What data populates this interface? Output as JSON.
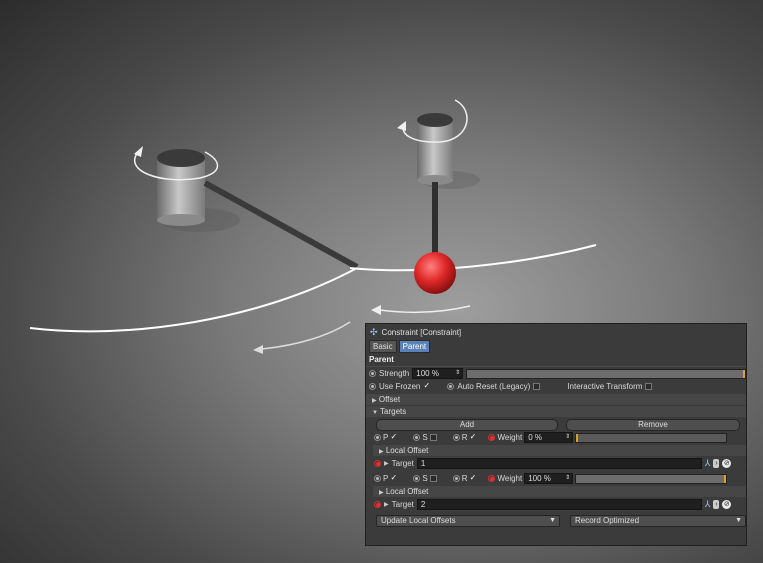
{
  "panel": {
    "title": "Constraint [Constraint]",
    "tabs": [
      {
        "label": "Basic",
        "active": false
      },
      {
        "label": "Parent",
        "active": true
      }
    ],
    "section_title": "Parent",
    "strength": {
      "label": "Strength",
      "value": "100 %",
      "fraction": 1.0
    },
    "options": {
      "use_frozen": "Use Frozen",
      "auto_reset": "Auto Reset (Legacy)",
      "interactive_transform": "Interactive Transform"
    },
    "groups": {
      "offset": "Offset",
      "targets": "Targets",
      "local_offset": "Local Offset"
    },
    "buttons": {
      "add": "Add",
      "remove": "Remove"
    },
    "targets": [
      {
        "p": "P",
        "s": "S",
        "r": "R",
        "weight_label": "Weight",
        "weight_value": "0 %",
        "weight_fraction": 0.0,
        "target_label": "Target",
        "target_value": "1"
      },
      {
        "p": "P",
        "s": "S",
        "r": "R",
        "weight_label": "Weight",
        "weight_value": "100 %",
        "weight_fraction": 1.0,
        "target_label": "Target",
        "target_value": "2"
      }
    ],
    "bottom": {
      "update_local_offsets": "Update Local Offsets",
      "record_mode": "Record Optimized"
    }
  },
  "colors": {
    "accent": "#5a82b8",
    "ball": "#e02828",
    "slider_marker": "#e0a020"
  }
}
